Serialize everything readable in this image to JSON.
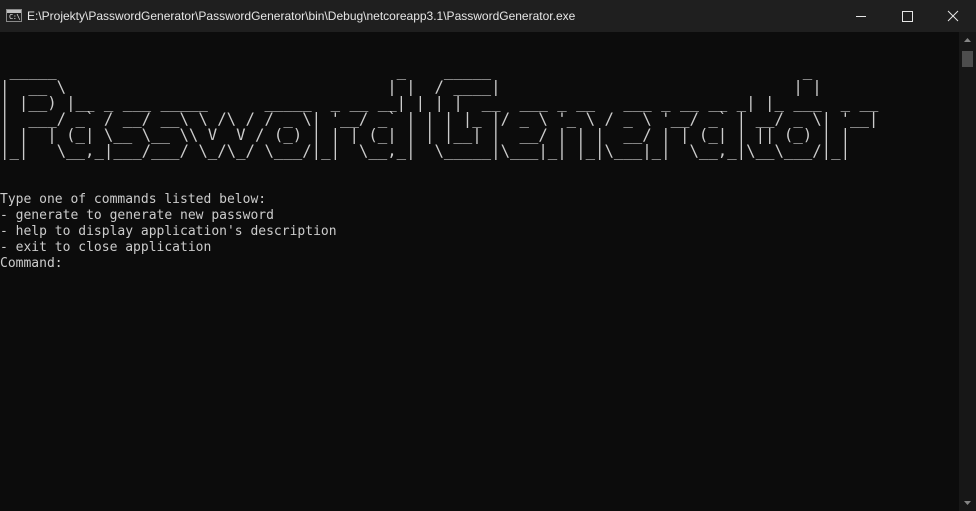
{
  "window": {
    "title": "E:\\Projekty\\PasswordGenerator\\PasswordGenerator\\bin\\Debug\\netcoreapp3.1\\PasswordGenerator.exe",
    "icon_text": "C:\\",
    "controls": {
      "minimize_icon": "minimize-icon",
      "maximize_icon": "maximize-icon",
      "close_icon": "close-icon"
    }
  },
  "console": {
    "banner_lines": [
      " _____                                    _    _____                                 _             ",
      "|  __ \\                                  | |  / ____|                               | |            ",
      "| |__) |__ _ ___ _____      _____  _ __ __| | | |  __  ___ _ __   ___ _ __ __ _| |_ ___  _ __ ",
      "|  ___/ _` / __/ __\\ \\ /\\ / / _ \\| '__/ _` | | | |_ |/ _ \\ '_ \\ / _ \\ '__/ _` | __/ _ \\| '__|",
      "| |  | (_| \\__ \\__ \\\\ V  V / (_) | | | (_| | | |__| |  __/ | | |  __/ | | (_| | || (_) | |   ",
      "|_|   \\__,_|___/___/ \\_/\\_/ \\___/|_|  \\__,_|  \\_____|\\___|_| |_|\\___|_|  \\__,_|\\__\\___/|_|   "
    ],
    "output_lines": [
      "Type one of commands listed below:",
      "- generate to generate new password",
      "- help to display application's description",
      "- exit to close application",
      "Command:"
    ]
  },
  "colors": {
    "console_background": "#0c0c0c",
    "console_text": "#cccccc",
    "titlebar_background": "#1f1f1f",
    "title_text": "#e6e6e6"
  }
}
